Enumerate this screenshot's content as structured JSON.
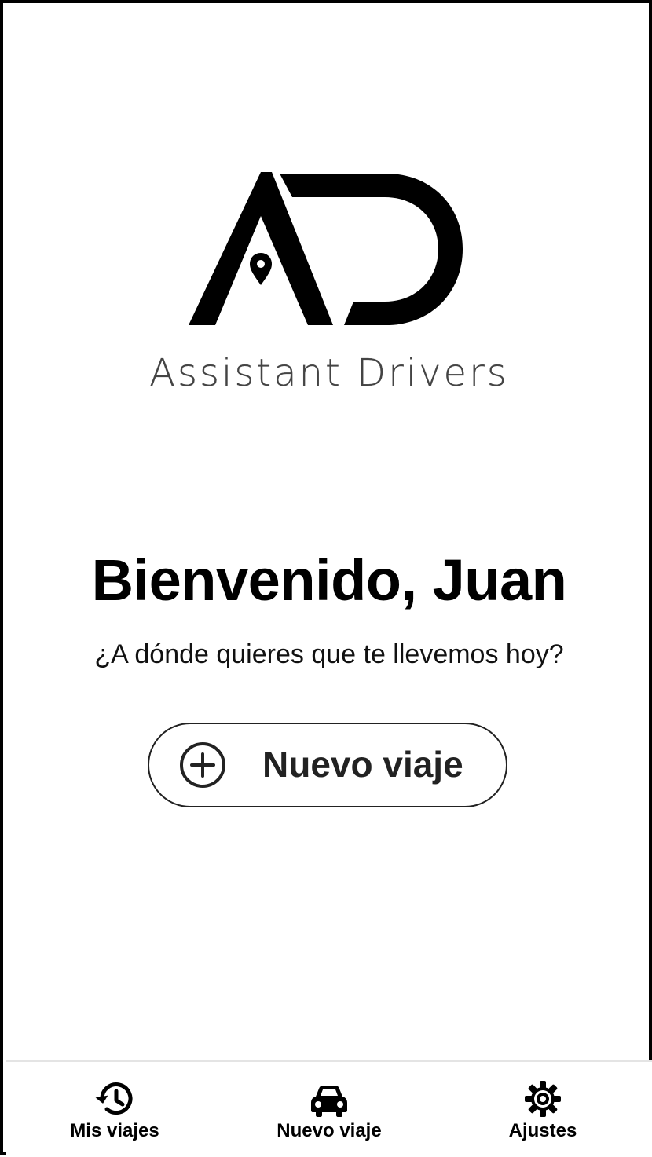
{
  "brand": {
    "name": "Assistant Drivers",
    "logo_icon": "ad-logo-icon",
    "color": "#111111"
  },
  "home": {
    "welcome": "Bienvenido, Juan",
    "subtitle": "¿A dónde quieres que te llevemos hoy?",
    "new_trip_button": {
      "label": "Nuevo viaje",
      "icon": "plus-circle-icon"
    }
  },
  "bottom_nav": {
    "items": [
      {
        "label": "Mis viajes",
        "icon": "history-icon"
      },
      {
        "label": "Nuevo viaje",
        "icon": "car-icon"
      },
      {
        "label": "Ajustes",
        "icon": "gear-icon"
      }
    ]
  }
}
